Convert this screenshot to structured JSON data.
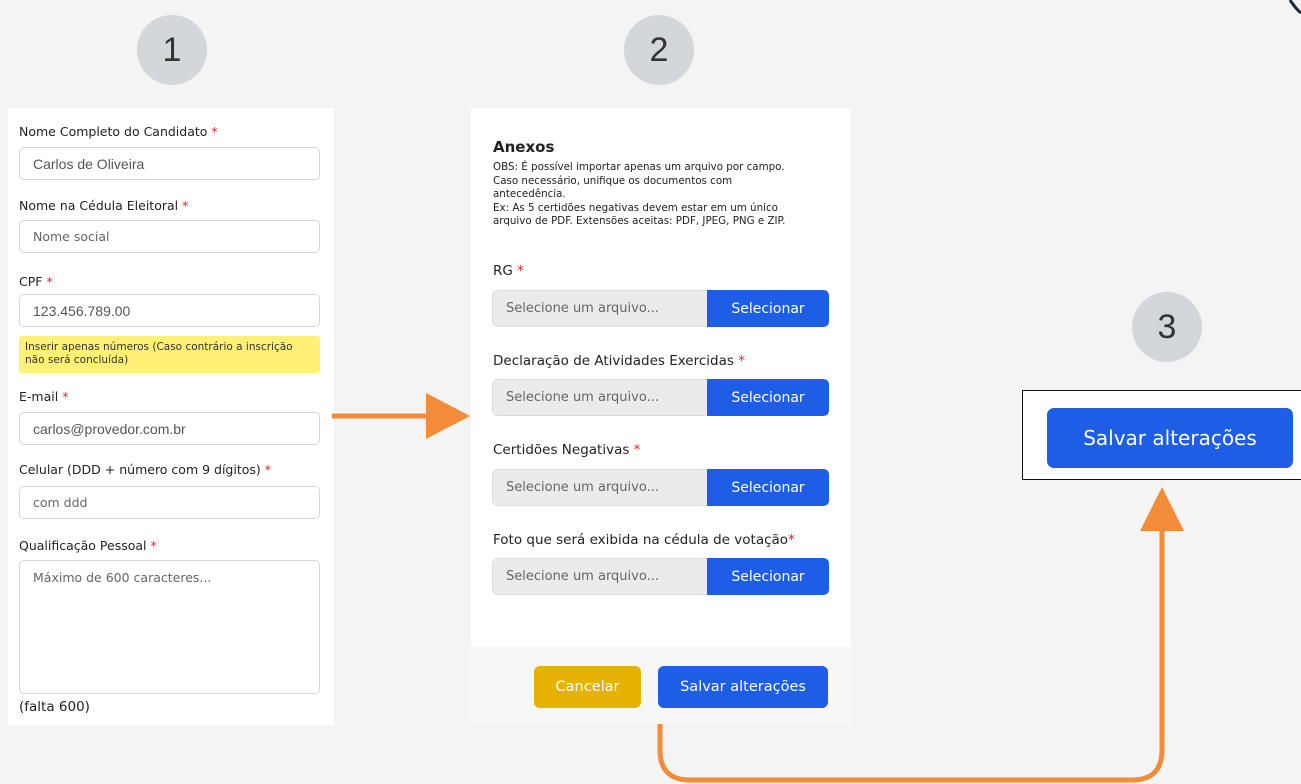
{
  "steps": {
    "one": "1",
    "two": "2",
    "three": "3"
  },
  "form": {
    "full_name_label": "Nome Completo do Candidato",
    "full_name_value": "Carlos de Oliveira",
    "ballot_name_label": "Nome na Cédula Eleitoral",
    "ballot_name_placeholder": "Nome social",
    "cpf_label": "CPF",
    "cpf_value": "123.456.789.00",
    "cpf_hint": "Inserir apenas números (Caso contrário a inscrição não será concluída)",
    "email_label": "E-mail",
    "email_value": "carlos@provedor.com.br",
    "phone_label": "Celular (DDD + número com 9 dígitos)",
    "phone_placeholder": "com ddd",
    "qualification_label": "Qualificação Pessoal",
    "qualification_placeholder": "Máximo de 600 caracteres...",
    "char_counter": "(falta 600)",
    "required_marker": "*"
  },
  "attachments": {
    "title": "Anexos",
    "obs_lines": [
      "OBS: É possível importar apenas um arquivo por campo.",
      "Caso necessário, unifique os documentos com",
      "antecedência.",
      "Ex: As 5 certidões negativas devem estar em um único",
      "arquivo de PDF. Extensões aceitas: PDF, JPEG, PNG e ZIP."
    ],
    "fields": [
      {
        "label": "RG",
        "placeholder": "Selecione um arquivo...",
        "button": "Selecionar"
      },
      {
        "label": "Declaração de Atividades Exercidas",
        "placeholder": "Selecione um arquivo...",
        "button": "Selecionar"
      },
      {
        "label": "Certidões Negativas",
        "placeholder": "Selecione um arquivo...",
        "button": "Selecionar"
      },
      {
        "label": "Foto que será exibida na cédula de votação",
        "placeholder": "Selecione um arquivo...",
        "button": "Selecionar"
      }
    ],
    "cancel_label": "Cancelar",
    "save_label": "Salvar alterações"
  },
  "highlight": {
    "save_label": "Salvar alterações"
  },
  "colors": {
    "primary": "#1e5ee6",
    "cancel": "#e6b200",
    "arrow": "#f28c38",
    "hint_bg": "#fff176",
    "required": "#e02424"
  }
}
